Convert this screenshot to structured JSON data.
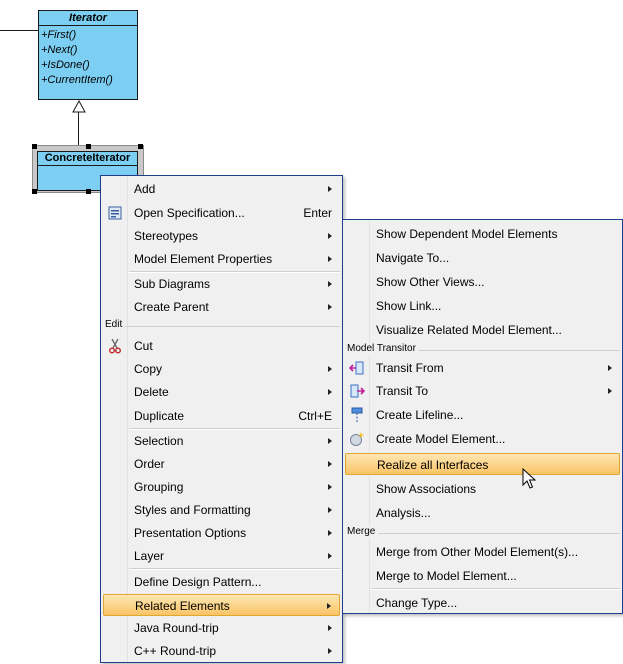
{
  "diagram": {
    "iterator": {
      "name": "Iterator",
      "operations": [
        "+First()",
        "+Next()",
        "+IsDone()",
        "+CurrentItem()"
      ]
    },
    "concrete_iterator": {
      "name": "ConcreteIterator"
    }
  },
  "context_menu": {
    "items": [
      {
        "label": "Add"
      },
      {
        "label": "Open Specification...",
        "shortcut": "Enter",
        "icon": "open-specification-icon"
      },
      {
        "label": "Stereotypes"
      },
      {
        "label": "Model Element Properties"
      },
      {
        "label": "Sub Diagrams"
      },
      {
        "label": "Create Parent"
      },
      {
        "label": "Cut",
        "icon": "scissors-icon"
      },
      {
        "label": "Copy"
      },
      {
        "label": "Delete"
      },
      {
        "label": "Duplicate",
        "shortcut": "Ctrl+E"
      },
      {
        "label": "Selection"
      },
      {
        "label": "Order"
      },
      {
        "label": "Grouping"
      },
      {
        "label": "Styles and Formatting"
      },
      {
        "label": "Presentation Options"
      },
      {
        "label": "Layer"
      },
      {
        "label": "Define Design Pattern..."
      },
      {
        "label": "Related Elements"
      },
      {
        "label": "Java Round-trip"
      },
      {
        "label": "C++ Round-trip"
      }
    ],
    "groups": {
      "edit": "Edit"
    }
  },
  "submenu": {
    "items": [
      {
        "label": "Show Dependent Model Elements"
      },
      {
        "label": "Navigate To..."
      },
      {
        "label": "Show Other Views..."
      },
      {
        "label": "Show Link..."
      },
      {
        "label": "Visualize Related Model Element..."
      },
      {
        "label": "Transit From",
        "icon": "transit-from-icon"
      },
      {
        "label": "Transit To",
        "icon": "transit-to-icon"
      },
      {
        "label": "Create Lifeline...",
        "icon": "lifeline-icon"
      },
      {
        "label": "Create Model Element...",
        "icon": "model-element-icon"
      },
      {
        "label": "Realize all Interfaces"
      },
      {
        "label": "Show Associations"
      },
      {
        "label": "Analysis..."
      },
      {
        "label": "Merge from Other Model Element(s)..."
      },
      {
        "label": "Merge to Model Element..."
      },
      {
        "label": "Change Type..."
      }
    ],
    "groups": {
      "model_transitor": "Model Transitor",
      "merge": "Merge"
    }
  },
  "colors": {
    "class_fill": "#7ccff2",
    "menu_bg": "#f0f0f0",
    "menu_border": "#1f3e8c",
    "highlight": "#f9c466"
  }
}
